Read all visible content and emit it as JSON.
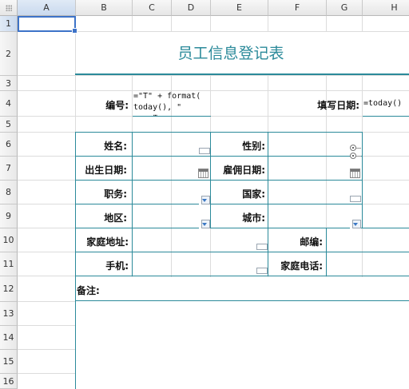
{
  "columns": [
    "A",
    "B",
    "C",
    "D",
    "E",
    "F",
    "G",
    "H"
  ],
  "rows": [
    "1",
    "2",
    "3",
    "4",
    "5",
    "6",
    "7",
    "8",
    "9",
    "10",
    "11",
    "12",
    "13",
    "14",
    "15",
    "16"
  ],
  "form": {
    "title": "员工信息登记表",
    "id_label": "编号:",
    "id_formula_line1": "=\"T\" + format(",
    "id_formula_line2": "today(), \"",
    "id_formula_line3": "…",
    "date_label": "填写日期:",
    "date_formula": "=today()",
    "name_label": "姓名:",
    "gender_label": "性别:",
    "birth_label": "出生日期:",
    "hire_label": "雇佣日期:",
    "position_label": "职务:",
    "country_label": "国家:",
    "region_label": "地区:",
    "city_label": "城市:",
    "address_label": "家庭地址:",
    "zip_label": "邮编:",
    "mobile_label": "手机:",
    "homephone_label": "家庭电话:",
    "notes_label": "备注:"
  },
  "colors": {
    "accent": "#2b8a9a",
    "selection": "#3d73c8"
  }
}
